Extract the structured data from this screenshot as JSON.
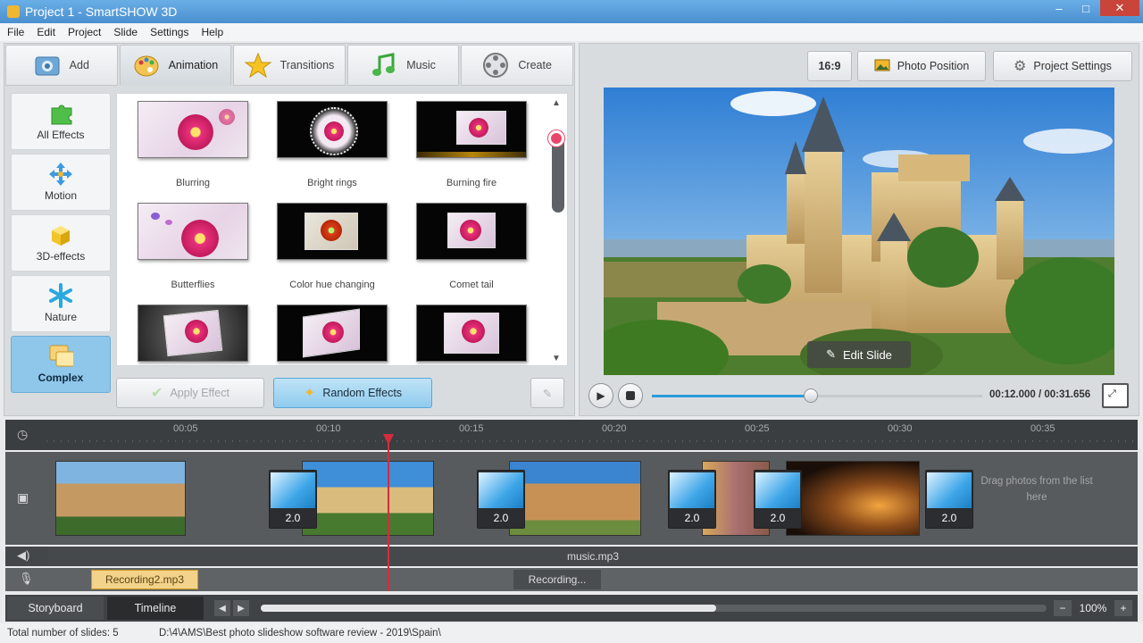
{
  "window": {
    "title": "Project 1 - SmartSHOW 3D",
    "min": "–",
    "max": "□",
    "close": "✕"
  },
  "menu": [
    "File",
    "Edit",
    "Project",
    "Slide",
    "Settings",
    "Help"
  ],
  "tabs": [
    {
      "label": "Add",
      "icon": "add-photo-icon"
    },
    {
      "label": "Animation",
      "icon": "palette-icon",
      "active": true
    },
    {
      "label": "Transitions",
      "icon": "star-icon"
    },
    {
      "label": "Music",
      "icon": "music-note-icon"
    },
    {
      "label": "Create",
      "icon": "film-reel-icon"
    }
  ],
  "categories": [
    {
      "label": "All Effects",
      "icon": "puzzle-icon"
    },
    {
      "label": "Motion",
      "icon": "move-arrows-icon"
    },
    {
      "label": "3D-effects",
      "icon": "cube-icon"
    },
    {
      "label": "Nature",
      "icon": "snowflake-icon"
    },
    {
      "label": "Complex",
      "icon": "layers-icon",
      "active": true
    }
  ],
  "effects": [
    {
      "label": "Blurring"
    },
    {
      "label": "Bright rings"
    },
    {
      "label": "Burning fire"
    },
    {
      "label": "Butterflies"
    },
    {
      "label": "Color hue changing"
    },
    {
      "label": "Comet tail"
    },
    {
      "label": ""
    },
    {
      "label": ""
    },
    {
      "label": ""
    }
  ],
  "actions": {
    "apply": "Apply Effect",
    "random": "Random Effects"
  },
  "preview": {
    "aspect": "16:9",
    "photo_position": "Photo Position",
    "project_settings": "Project Settings",
    "edit_slide": "Edit Slide",
    "time_current": "00:12.000",
    "time_total": "00:31.656",
    "time_separator": " / ",
    "progress": 0.48
  },
  "timeline": {
    "ticks": [
      "00:05",
      "00:10",
      "00:15",
      "00:20",
      "00:25",
      "00:30",
      "00:35"
    ],
    "transitions": [
      "2.0",
      "2.0",
      "2.0",
      "2.0",
      "2.0"
    ],
    "drag_hint": "Drag photos from the list here",
    "music_file": "music.mp3",
    "recording_file": "Recording2.mp3",
    "recording_status": "Recording..."
  },
  "bottom": {
    "storyboard": "Storyboard",
    "timeline": "Timeline",
    "zoom": "100%",
    "minus": "−",
    "plus": "+"
  },
  "status": {
    "slides": "Total number of slides: 5",
    "path": "D:\\4\\AMS\\Best photo slideshow software review - 2019\\Spain\\"
  },
  "colors": {
    "accent": "#2c9ad8",
    "playhead": "#d62b3c",
    "active_category": "#8ec7ea"
  }
}
